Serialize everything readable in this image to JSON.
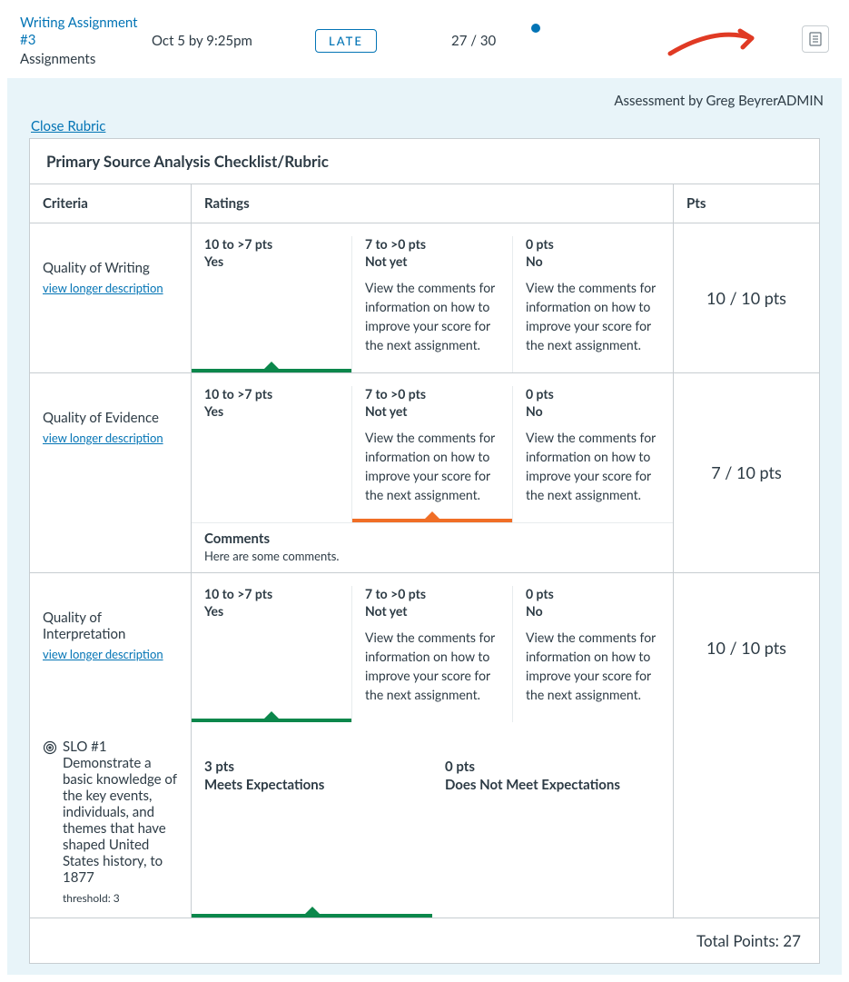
{
  "header": {
    "assignment_title": "Writing Assignment #3",
    "assignment_category": "Assignments",
    "due": "Oct 5 by 9:25pm",
    "late_label": "LATE",
    "score": "27 / 30"
  },
  "panel": {
    "assessor_prefix": "Assessment by ",
    "assessor_name": "Greg BeyrerADMIN",
    "close_label": "Close Rubric",
    "rubric_title": "Primary Source Analysis Checklist/Rubric",
    "head_criteria": "Criteria",
    "head_ratings": "Ratings",
    "head_pts": "Pts",
    "total_label": "Total Points: 27"
  },
  "rows": [
    {
      "criteria": "Quality of Writing",
      "longer": "view longer description",
      "tiers": [
        {
          "pts": "10 to >7 pts",
          "label": "Yes",
          "desc": "",
          "selected": true,
          "color": "green"
        },
        {
          "pts": "7 to >0 pts",
          "label": "Not yet",
          "desc": "View the comments for information on how to improve your score for the next assignment."
        },
        {
          "pts": "0 pts",
          "label": "No",
          "desc": "View the comments for information on how to improve your score for the next assignment."
        }
      ],
      "score": "10 / 10 pts"
    },
    {
      "criteria": "Quality of Evidence",
      "longer": "view longer description",
      "tiers": [
        {
          "pts": "10 to >7 pts",
          "label": "Yes",
          "desc": ""
        },
        {
          "pts": "7 to >0 pts",
          "label": "Not yet",
          "desc": "View the comments for information on how to improve your score for the next assignment.",
          "selected": true,
          "color": "orange"
        },
        {
          "pts": "0 pts",
          "label": "No",
          "desc": "View the comments for information on how to improve your score for the next assignment."
        }
      ],
      "comments_title": "Comments",
      "comments_text": "Here are some comments.",
      "score": "7 / 10 pts"
    },
    {
      "criteria": "Quality of Interpretation",
      "longer": "view longer description",
      "tiers": [
        {
          "pts": "10 to >7 pts",
          "label": "Yes",
          "desc": "",
          "selected": true,
          "color": "green"
        },
        {
          "pts": "7 to >0 pts",
          "label": "Not yet",
          "desc": "View the comments for information on how to improve your score for the next assignment."
        },
        {
          "pts": "0 pts",
          "label": "No",
          "desc": "View the comments for information on how to improve your score for the next assignment."
        }
      ],
      "score": "10 / 10 pts"
    }
  ],
  "slo": {
    "criteria": "SLO #1 Demonstrate a basic knowledge of the key events, individuals, and themes that have shaped United States history, to 1877",
    "threshold": "threshold: 3",
    "tiers": [
      {
        "pts": "3 pts",
        "label": "Meets Expectations",
        "selected": true,
        "color": "green"
      },
      {
        "pts": "0 pts",
        "label": "Does Not Meet Expectations"
      }
    ]
  }
}
